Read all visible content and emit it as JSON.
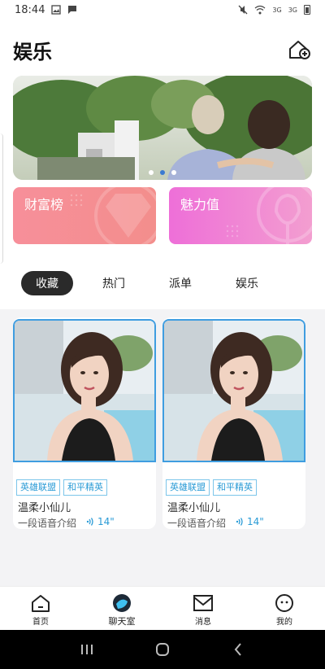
{
  "status_bar": {
    "time": "18:44",
    "signal_3g_a": "3G",
    "signal_3g_b": "3G"
  },
  "header": {
    "title": "娱乐"
  },
  "banner": {
    "slide_count": 3,
    "active_slide": 1
  },
  "cards": {
    "wealth_label": "财富榜",
    "charm_label": "魅力值"
  },
  "tabs": [
    {
      "label": "收藏",
      "active": true
    },
    {
      "label": "热门",
      "active": false
    },
    {
      "label": "派单",
      "active": false
    },
    {
      "label": "娱乐",
      "active": false
    }
  ],
  "profiles": [
    {
      "tag1": "英雄联盟",
      "tag2": "和平精英",
      "name": "温柔小仙儿",
      "intro": "一段语音介绍",
      "voice_duration": "14\""
    },
    {
      "tag1": "英雄联盟",
      "tag2": "和平精英",
      "name": "温柔小仙儿",
      "intro": "一段语音介绍",
      "voice_duration": "14\""
    }
  ],
  "bottom_nav": [
    {
      "label": "首页",
      "icon": "home-icon"
    },
    {
      "label": "聊天室",
      "icon": "chatroom-icon"
    },
    {
      "label": "消息",
      "icon": "mail-icon"
    },
    {
      "label": "我的",
      "icon": "smiley-icon"
    }
  ],
  "colors": {
    "accent": "#2a9bd6",
    "wealth_card": "#f78f9a",
    "charm_card": "#ee6fd8",
    "active_tab": "#2a2a2a"
  }
}
